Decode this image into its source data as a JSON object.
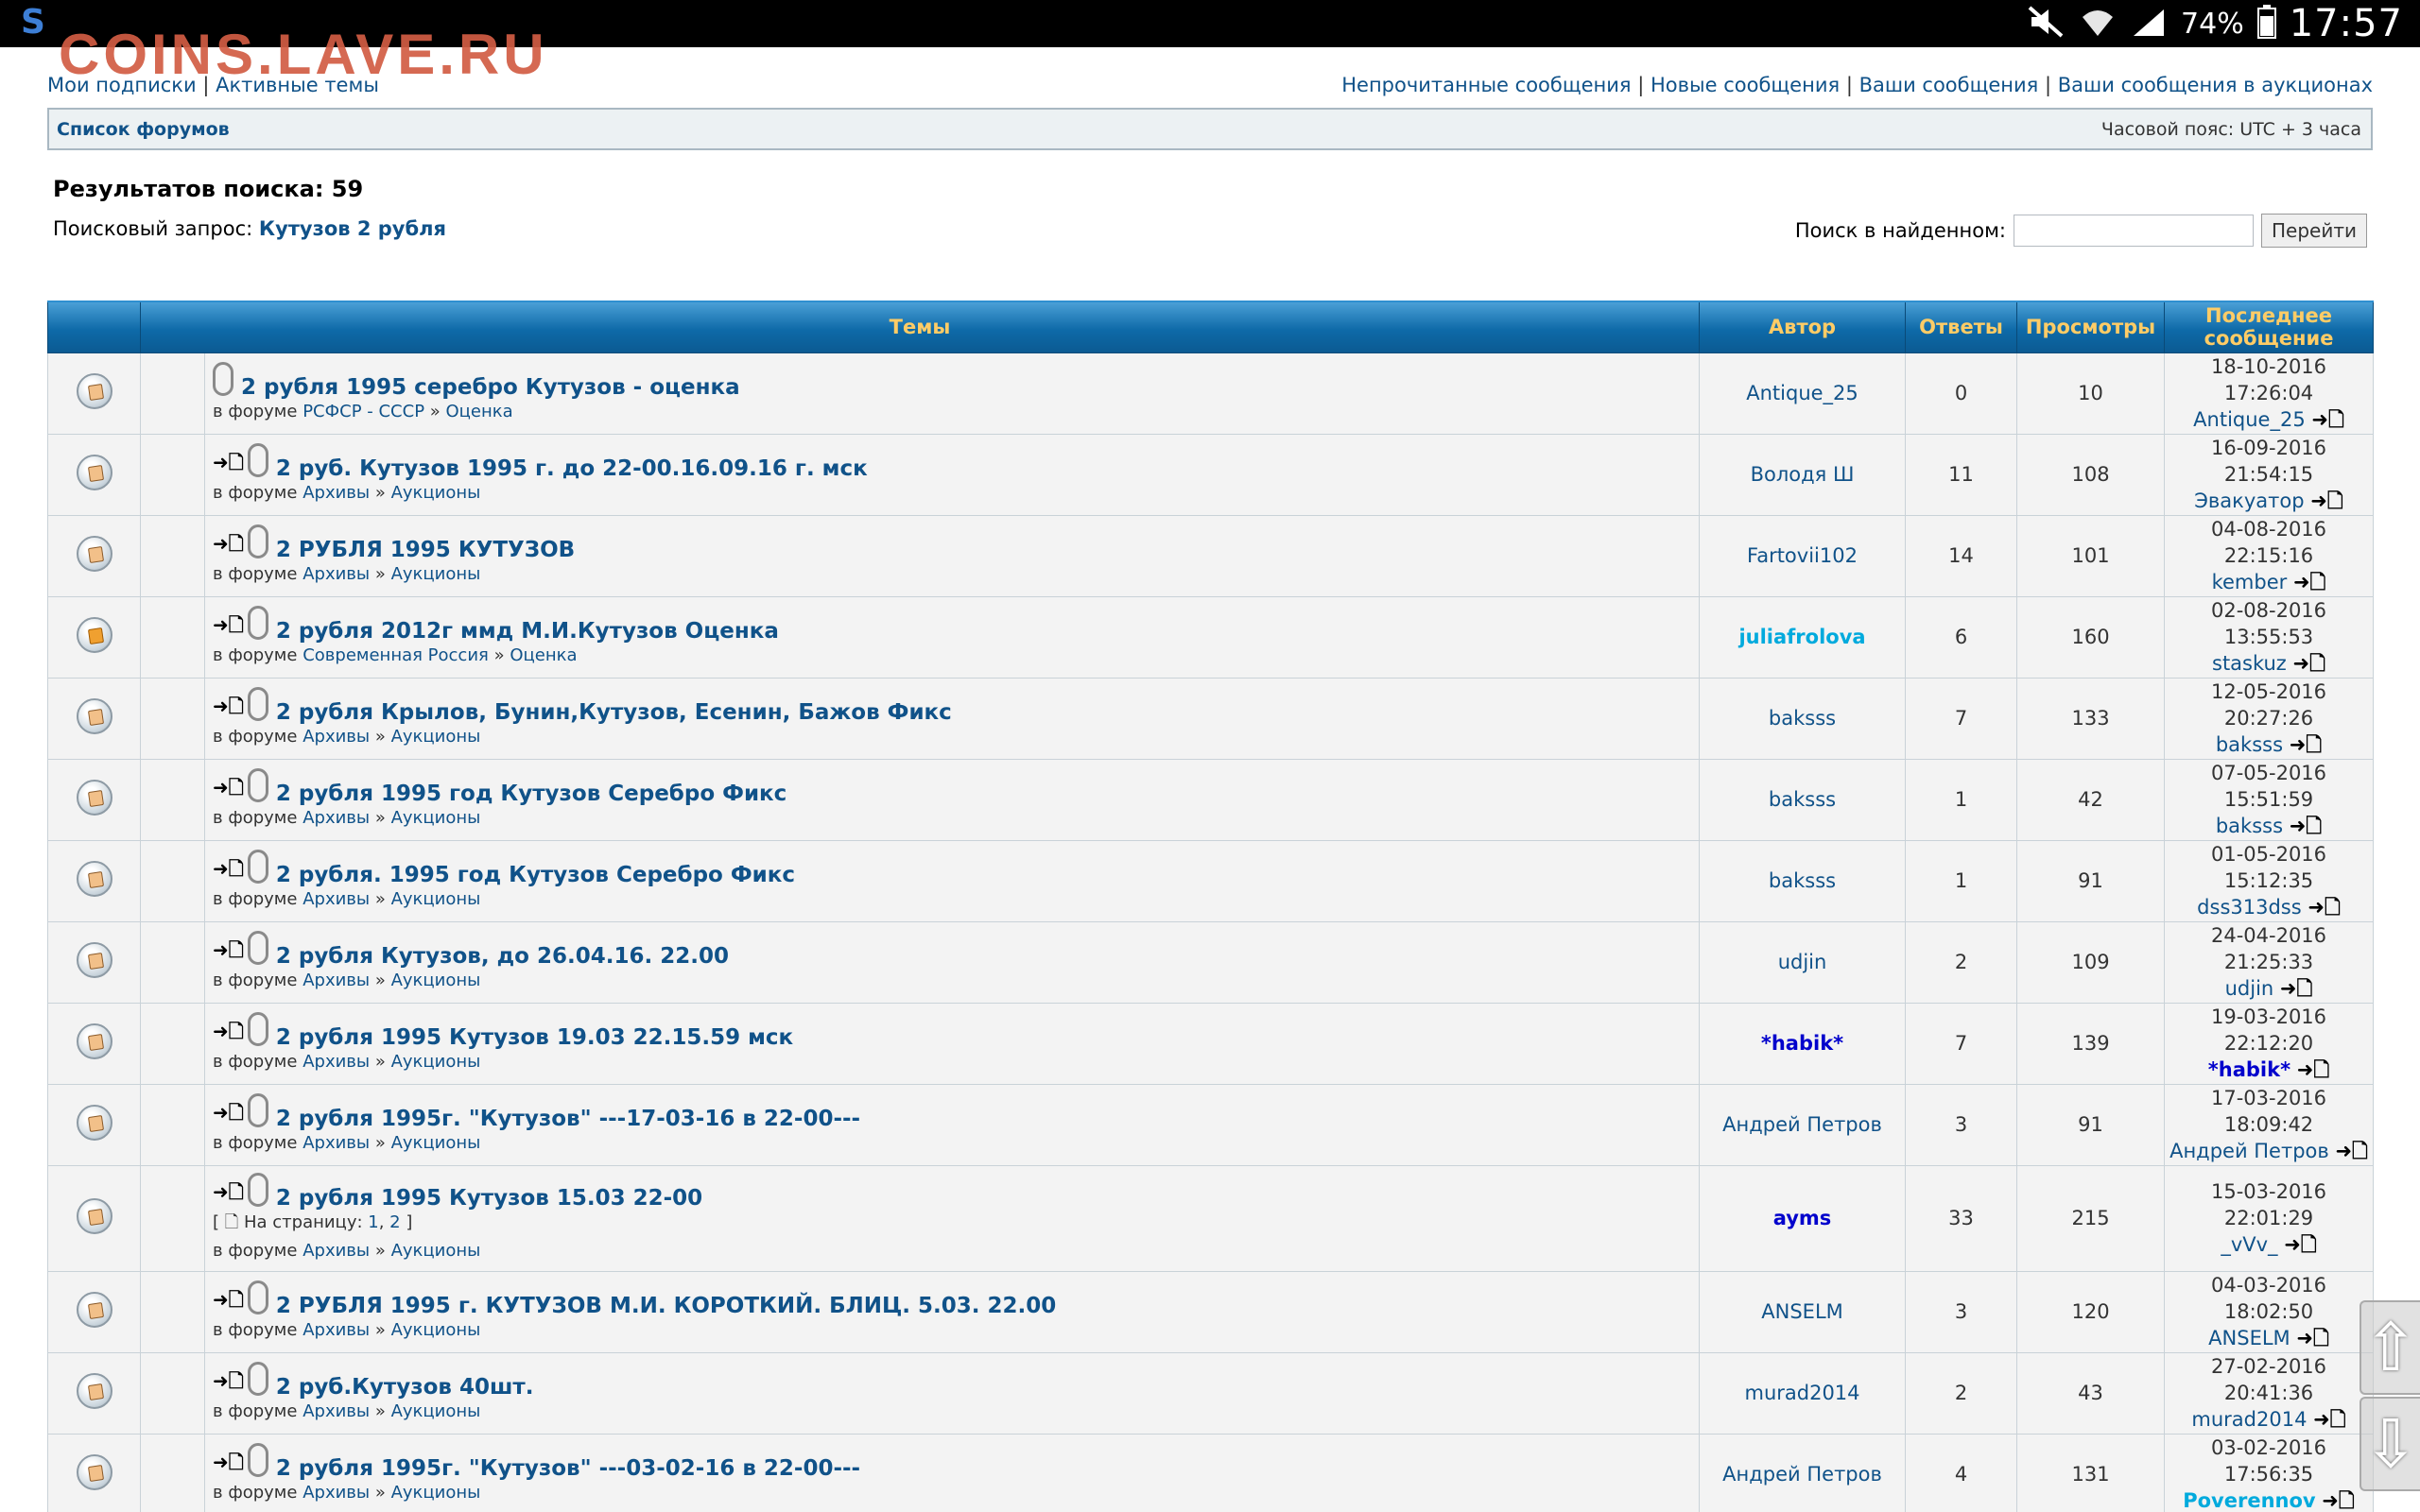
{
  "status_bar": {
    "battery": "74%",
    "time": "17:57",
    "icons": [
      "mute-icon",
      "wifi-icon",
      "signal-icon",
      "battery-icon"
    ]
  },
  "logo": "COINS.LAVE.RU",
  "top_links_left": [
    "Мои подписки",
    "Активные темы"
  ],
  "top_links_right": [
    "Непрочитанные сообщения",
    "Новые сообщения",
    "Ваши сообщения",
    "Ваши сообщения в аукционах"
  ],
  "navbar": {
    "forum_list": "Список форумов",
    "timezone": "Часовой пояс: UTC + 3 часа"
  },
  "search": {
    "results": "Результатов поиска: 59",
    "query_label": "Поисковый запрос:",
    "query": "Кутузов 2 рубля",
    "within_label": "Поиск в найденном:",
    "within_value": "",
    "go_button": "Перейти"
  },
  "table": {
    "headers": {
      "topics": "Темы",
      "author": "Автор",
      "replies": "Ответы",
      "views": "Просмотры",
      "last_post": "Последнее сообщение"
    },
    "in_forum_label": "в форуме",
    "rows": [
      {
        "title": "2 рубля 1995 серебро Кутузов - оценка",
        "goto": false,
        "forum1": "РСФСР - СССР",
        "forum2": "Оценка",
        "author": "Antique_25",
        "author_style": "",
        "replies": "0",
        "views": "10",
        "last_date": "18-10-2016 17:26:04",
        "last_user": "Antique_25",
        "last_style": "",
        "locked": false
      },
      {
        "title": "2 руб. Кутузов 1995 г. до 22-00.16.09.16 г. мск",
        "goto": true,
        "forum1": "Архивы",
        "forum2": "Аукционы",
        "author": "Володя Ш",
        "author_style": "",
        "replies": "11",
        "views": "108",
        "last_date": "16-09-2016 21:54:15",
        "last_user": "Эвакуатор",
        "last_style": "",
        "locked": false
      },
      {
        "title": "2 РУБЛЯ 1995 КУТУЗОВ",
        "goto": true,
        "forum1": "Архивы",
        "forum2": "Аукционы",
        "author": "Fartovii102",
        "author_style": "",
        "replies": "14",
        "views": "101",
        "last_date": "04-08-2016 22:15:16",
        "last_user": "kember",
        "last_style": "",
        "locked": false
      },
      {
        "title": "2 рубля 2012г ммд М.И.Кутузов Оценка",
        "goto": true,
        "forum1": "Современная Россия",
        "forum2": "Оценка",
        "author": "juliafrolova",
        "author_style": "cyan",
        "replies": "6",
        "views": "160",
        "last_date": "02-08-2016 13:55:53",
        "last_user": "staskuz",
        "last_style": "",
        "locked": true
      },
      {
        "title": "2 рубля Крылов, Бунин,Кутузов, Есенин, Бажов Фикс",
        "goto": true,
        "forum1": "Архивы",
        "forum2": "Аукционы",
        "author": "baksss",
        "author_style": "",
        "replies": "7",
        "views": "133",
        "last_date": "12-05-2016 20:27:26",
        "last_user": "baksss",
        "last_style": "",
        "locked": false
      },
      {
        "title": "2 рубля 1995 год Кутузов Серебро Фикс",
        "goto": true,
        "forum1": "Архивы",
        "forum2": "Аукционы",
        "author": "baksss",
        "author_style": "",
        "replies": "1",
        "views": "42",
        "last_date": "07-05-2016 15:51:59",
        "last_user": "baksss",
        "last_style": "",
        "locked": false
      },
      {
        "title": "2 рубля. 1995 год Кутузов Серебро Фикс",
        "goto": true,
        "forum1": "Архивы",
        "forum2": "Аукционы",
        "author": "baksss",
        "author_style": "",
        "replies": "1",
        "views": "91",
        "last_date": "01-05-2016 15:12:35",
        "last_user": "dss313dss",
        "last_style": "",
        "locked": false
      },
      {
        "title": "2 рубля Кутузов, до 26.04.16. 22.00",
        "goto": true,
        "forum1": "Архивы",
        "forum2": "Аукционы",
        "author": "udjin",
        "author_style": "",
        "replies": "2",
        "views": "109",
        "last_date": "24-04-2016 21:25:33",
        "last_user": "udjin",
        "last_style": "",
        "locked": false
      },
      {
        "title": "2 рубля 1995 Кутузов 19.03 22.15.59 мск",
        "goto": true,
        "forum1": "Архивы",
        "forum2": "Аукционы",
        "author": "*habik*",
        "author_style": "blue",
        "replies": "7",
        "views": "139",
        "last_date": "19-03-2016 22:12:20",
        "last_user": "*habik*",
        "last_style": "blue",
        "locked": false
      },
      {
        "title": "2 рубля 1995г. \"Кутузов\" ---17-03-16 в 22-00---",
        "goto": true,
        "forum1": "Архивы",
        "forum2": "Аукционы",
        "author": "Андрей Петров",
        "author_style": "",
        "replies": "3",
        "views": "91",
        "last_date": "17-03-2016 18:09:42",
        "last_user": "Андрей Петров",
        "last_style": "",
        "locked": false
      },
      {
        "title": "2 рубля 1995 Кутузов 15.03 22-00",
        "goto": true,
        "forum1": "Архивы",
        "forum2": "Аукционы",
        "author": "ayms",
        "author_style": "blue",
        "replies": "33",
        "views": "215",
        "last_date": "15-03-2016 22:01:29",
        "last_user": "_vVv_",
        "last_style": "",
        "locked": false,
        "pages_label": "На страницу:",
        "pages": [
          "1",
          "2"
        ]
      },
      {
        "title": "2 РУБЛЯ 1995 г. КУТУЗОВ М.И. КОРОТКИЙ. БЛИЦ. 5.03. 22.00",
        "goto": true,
        "forum1": "Архивы",
        "forum2": "Аукционы",
        "author": "ANSELM",
        "author_style": "",
        "replies": "3",
        "views": "120",
        "last_date": "04-03-2016 18:02:50",
        "last_user": "ANSELM",
        "last_style": "",
        "locked": false
      },
      {
        "title": "2 руб.Кутузов 40шт.",
        "goto": true,
        "forum1": "Архивы",
        "forum2": "Аукционы",
        "author": "murad2014",
        "author_style": "",
        "replies": "2",
        "views": "43",
        "last_date": "27-02-2016 20:41:36",
        "last_user": "murad2014",
        "last_style": "",
        "locked": false
      },
      {
        "title": "2 рубля 1995г. \"Кутузов\" ---03-02-16 в 22-00---",
        "goto": true,
        "forum1": "Архивы",
        "forum2": "Аукционы",
        "author": "Андрей Петров",
        "author_style": "",
        "replies": "4",
        "views": "131",
        "last_date": "03-02-2016 17:56:35",
        "last_user": "Poverennov",
        "last_style": "cyan",
        "locked": false
      }
    ]
  },
  "scroll": {
    "up": "⇧",
    "down": "⇩"
  }
}
